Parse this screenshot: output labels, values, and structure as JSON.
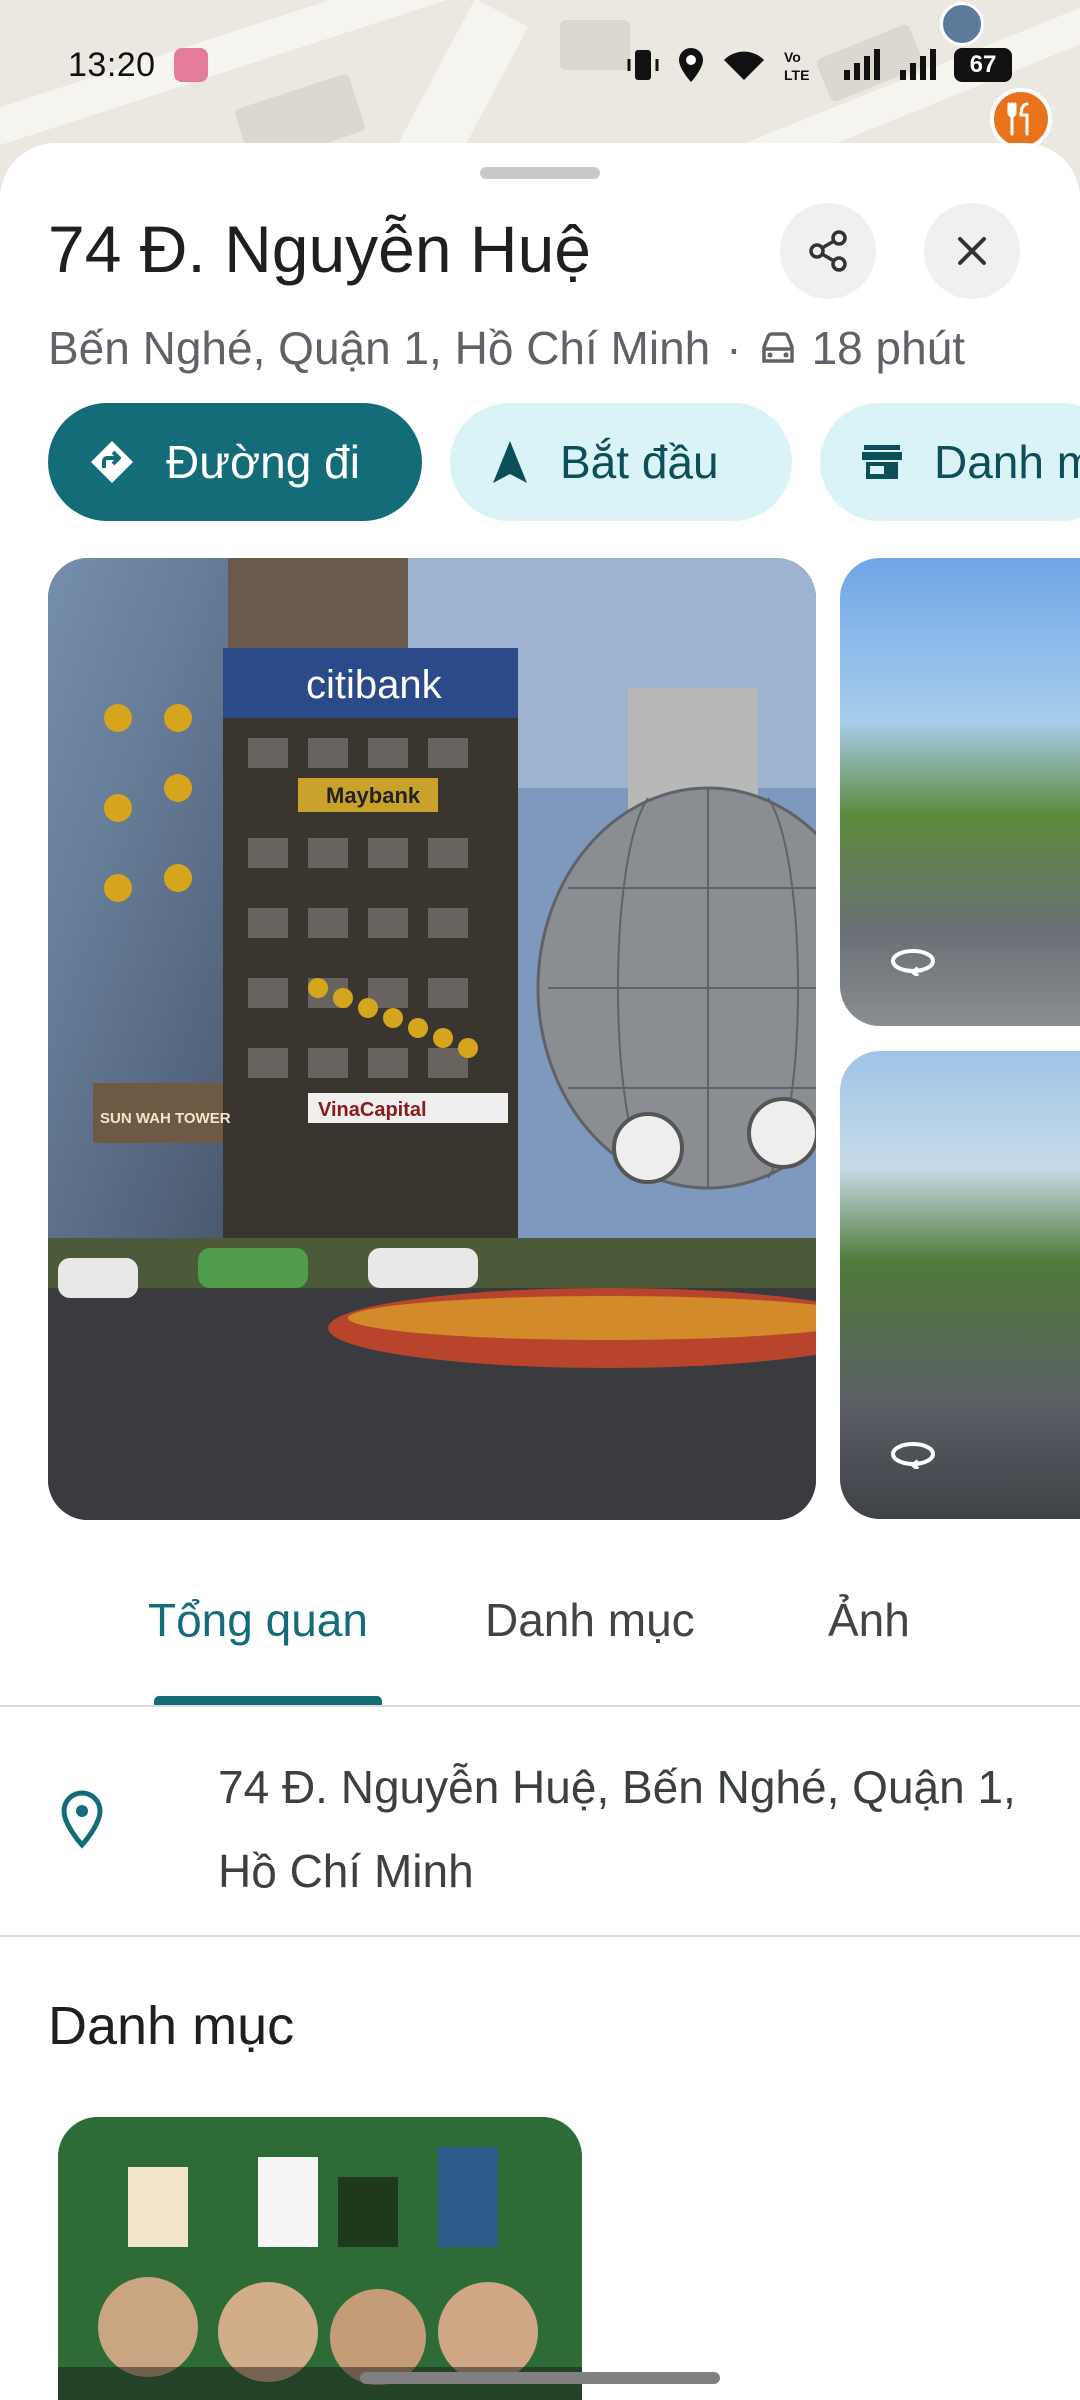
{
  "status_bar": {
    "time": "13:20",
    "battery": "67",
    "icons": [
      "vibrate-icon",
      "location-icon",
      "wifi-icon",
      "volte-icon",
      "signal-icon",
      "signal-icon"
    ]
  },
  "place": {
    "title": "74 Đ. Nguyễn Huệ",
    "locality": "Bến Nghé, Quận 1, Hồ Chí Minh",
    "separator": "·",
    "travel_time": "18 phút",
    "address_full": "74 Đ. Nguyễn Huệ, Bến Nghé, Quận 1, Hồ Chí Minh"
  },
  "actions": {
    "directions": "Đường đi",
    "start": "Bắt đầu",
    "menu": "Danh mục"
  },
  "photos": {
    "main_sign_1": "citibank",
    "main_sign_2": "Maybank",
    "main_sign_3": "SUN WAH TOWER",
    "main_sign_4": "VinaCapital"
  },
  "tabs": {
    "overview": "Tổng quan",
    "menu": "Danh mục",
    "photos": "Ảnh"
  },
  "section": {
    "menu_title": "Danh mục"
  },
  "colors": {
    "accent": "#146c79",
    "chip_light": "#d9f3f7",
    "poi_orange": "#e8731a"
  }
}
